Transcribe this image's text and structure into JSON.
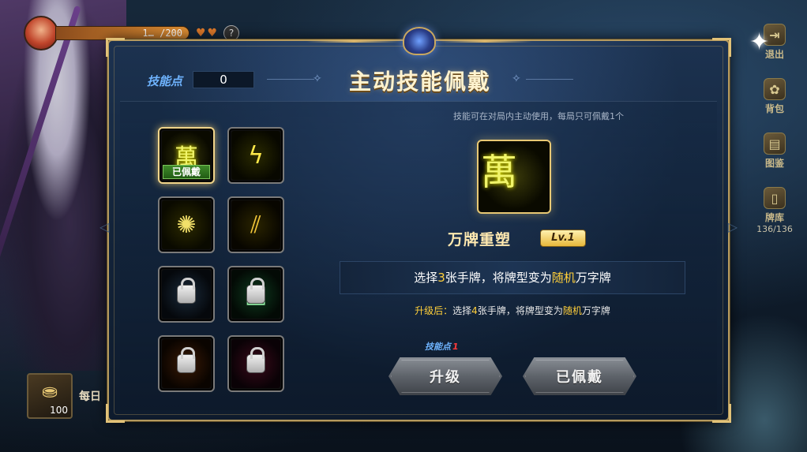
{
  "hud": {
    "resource_value": "1… /200",
    "hearts": "♥♥",
    "help": "?"
  },
  "sidebar": {
    "items": [
      {
        "icon": "exit-icon",
        "label": "退出",
        "sub": ""
      },
      {
        "icon": "bag-icon",
        "label": "背包",
        "sub": ""
      },
      {
        "icon": "book-icon",
        "label": "图鉴",
        "sub": ""
      },
      {
        "icon": "card-deck-icon",
        "label": "牌库",
        "sub": "136/136"
      }
    ]
  },
  "bottom_hud": {
    "chest_count": "100",
    "daily_label": "每日"
  },
  "modal": {
    "skill_points_label": "技能点",
    "skill_points_value": "0",
    "title": "主动技能佩戴",
    "hint": "技能可在对局内主动使用，每局只可佩戴1个",
    "skills": [
      {
        "name": "万牌重塑",
        "icon": "wan-rune-icon",
        "locked": false,
        "equipped": true
      },
      {
        "name": "",
        "icon": "lightning-burst-icon",
        "locked": false,
        "equipped": false
      },
      {
        "name": "",
        "icon": "paw-orb-icon",
        "locked": false,
        "equipped": false
      },
      {
        "name": "",
        "icon": "slash-cards-icon",
        "locked": false,
        "equipped": false
      },
      {
        "name": "",
        "icon": "frozen-cards-icon",
        "locked": true,
        "equipped": false
      },
      {
        "name": "",
        "icon": "green-cards-icon",
        "locked": true,
        "equipped": false
      },
      {
        "name": "",
        "icon": "flame-orb-icon",
        "locked": true,
        "equipped": false
      },
      {
        "name": "",
        "icon": "crimson-orb-icon",
        "locked": true,
        "equipped": false
      }
    ],
    "equipped_tag": "已佩戴",
    "selected": {
      "name": "万牌重塑",
      "level": "Lv.1",
      "desc_prefix": "选择",
      "desc_count": "3",
      "desc_middle": "张手牌，将牌型变为",
      "desc_random": "随机",
      "desc_suffix": "万字牌",
      "upgrade_prefix": "升级后：",
      "upgrade_pre": "选择",
      "upgrade_count": "4",
      "upgrade_middle": "张手牌，将牌型变为",
      "upgrade_random": "随机",
      "upgrade_suffix": "万字牌"
    },
    "cost_label": "技能点",
    "cost_value": "1",
    "upgrade_button": "升级",
    "equipped_button": "已佩戴"
  }
}
